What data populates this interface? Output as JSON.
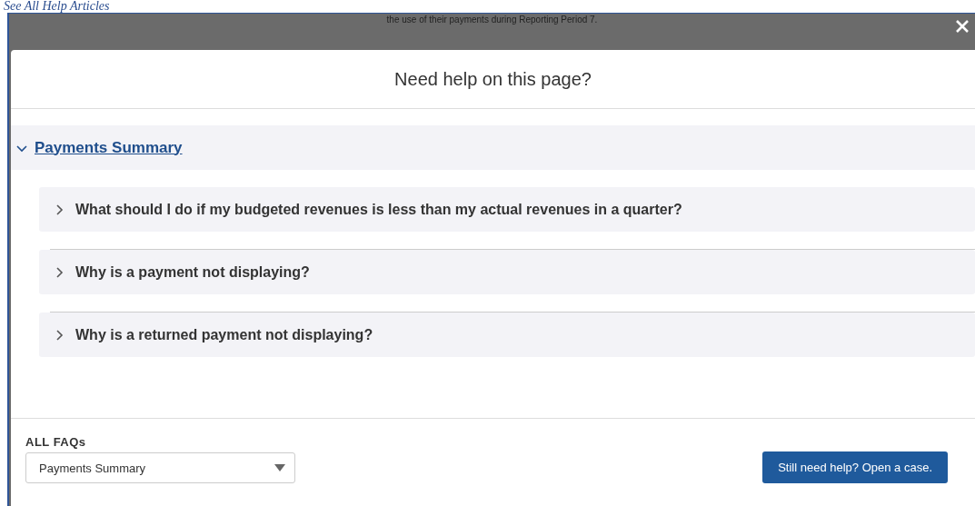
{
  "page_heading": "See All Help Articles",
  "background_text": "the use of their payments during Reporting Period 7.",
  "modal": {
    "title": "Need help on this page?",
    "section": {
      "title": "Payments Summary",
      "expanded": true,
      "items": [
        {
          "question": "What should I do if my budgeted revenues is less than my actual revenues in a quarter?",
          "expanded": false
        },
        {
          "question": "Why is a payment not displaying?",
          "expanded": false
        },
        {
          "question": "Why is a returned payment not displaying?",
          "expanded": false
        }
      ]
    },
    "footer": {
      "label": "ALL FAQs",
      "select_value": "Payments Summary",
      "button": "Still need help? Open a case."
    }
  }
}
